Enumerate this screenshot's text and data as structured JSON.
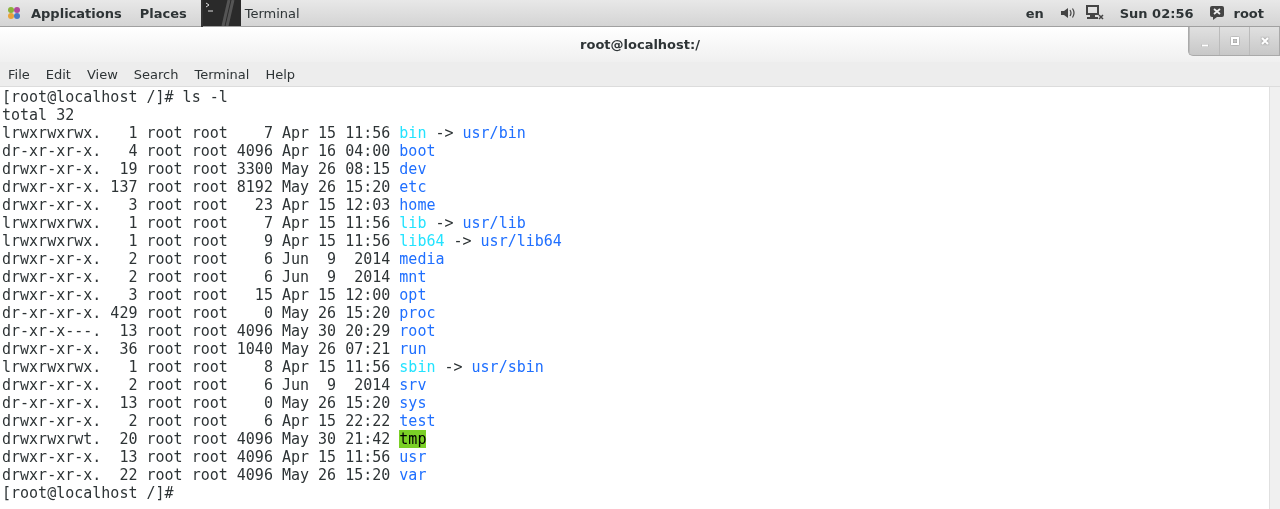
{
  "top_bar": {
    "menus": [
      "Applications",
      "Places"
    ],
    "task": {
      "label": "Terminal"
    },
    "language": "en",
    "clock": "Sun 02:56",
    "user": "root"
  },
  "window": {
    "title": "root@localhost:/"
  },
  "menu_bar": [
    "File",
    "Edit",
    "View",
    "Search",
    "Terminal",
    "Help"
  ],
  "terminal": {
    "lines": [
      {
        "kind": "text",
        "text": "[root@localhost /]# ls -l"
      },
      {
        "kind": "text",
        "text": "total 32"
      },
      {
        "kind": "entry",
        "info": "lrwxrwxrwx.   1 root root    7 Apr 15 11:56",
        "name": {
          "text": "bin",
          "kind": "link"
        },
        "arrow": "->",
        "target": "usr/bin"
      },
      {
        "kind": "entry",
        "info": "dr-xr-xr-x.   4 root root 4096 Apr 16 04:00",
        "name": {
          "text": "boot",
          "kind": "dir"
        }
      },
      {
        "kind": "entry",
        "info": "drwxr-xr-x.  19 root root 3300 May 26 08:15",
        "name": {
          "text": "dev",
          "kind": "dir"
        }
      },
      {
        "kind": "entry",
        "info": "drwxr-xr-x. 137 root root 8192 May 26 15:20",
        "name": {
          "text": "etc",
          "kind": "dir"
        }
      },
      {
        "kind": "entry",
        "info": "drwxr-xr-x.   3 root root   23 Apr 15 12:03",
        "name": {
          "text": "home",
          "kind": "dir"
        }
      },
      {
        "kind": "entry",
        "info": "lrwxrwxrwx.   1 root root    7 Apr 15 11:56",
        "name": {
          "text": "lib",
          "kind": "link"
        },
        "arrow": "->",
        "target": "usr/lib"
      },
      {
        "kind": "entry",
        "info": "lrwxrwxrwx.   1 root root    9 Apr 15 11:56",
        "name": {
          "text": "lib64",
          "kind": "link"
        },
        "arrow": "->",
        "target": "usr/lib64"
      },
      {
        "kind": "entry",
        "info": "drwxr-xr-x.   2 root root    6 Jun  9  2014",
        "name": {
          "text": "media",
          "kind": "dir"
        }
      },
      {
        "kind": "entry",
        "info": "drwxr-xr-x.   2 root root    6 Jun  9  2014",
        "name": {
          "text": "mnt",
          "kind": "dir"
        }
      },
      {
        "kind": "entry",
        "info": "drwxr-xr-x.   3 root root   15 Apr 15 12:00",
        "name": {
          "text": "opt",
          "kind": "dir"
        }
      },
      {
        "kind": "entry",
        "info": "dr-xr-xr-x. 429 root root    0 May 26 15:20",
        "name": {
          "text": "proc",
          "kind": "dir"
        }
      },
      {
        "kind": "entry",
        "info": "dr-xr-x---.  13 root root 4096 May 30 20:29",
        "name": {
          "text": "root",
          "kind": "dir"
        }
      },
      {
        "kind": "entry",
        "info": "drwxr-xr-x.  36 root root 1040 May 26 07:21",
        "name": {
          "text": "run",
          "kind": "dir"
        }
      },
      {
        "kind": "entry",
        "info": "lrwxrwxrwx.   1 root root    8 Apr 15 11:56",
        "name": {
          "text": "sbin",
          "kind": "link"
        },
        "arrow": "->",
        "target": "usr/sbin"
      },
      {
        "kind": "entry",
        "info": "drwxr-xr-x.   2 root root    6 Jun  9  2014",
        "name": {
          "text": "srv",
          "kind": "dir"
        }
      },
      {
        "kind": "entry",
        "info": "dr-xr-xr-x.  13 root root    0 May 26 15:20",
        "name": {
          "text": "sys",
          "kind": "dir"
        }
      },
      {
        "kind": "entry",
        "info": "drwxr-xr-x.   2 root root    6 Apr 15 22:22",
        "name": {
          "text": "test",
          "kind": "dir"
        }
      },
      {
        "kind": "entry",
        "info": "drwxrwxrwt.  20 root root 4096 May 30 21:42",
        "name": {
          "text": "tmp",
          "kind": "sticky"
        }
      },
      {
        "kind": "entry",
        "info": "drwxr-xr-x.  13 root root 4096 Apr 15 11:56",
        "name": {
          "text": "usr",
          "kind": "dir"
        }
      },
      {
        "kind": "entry",
        "info": "drwxr-xr-x.  22 root root 4096 May 26 15:20",
        "name": {
          "text": "var",
          "kind": "dir"
        }
      },
      {
        "kind": "text",
        "text": "[root@localhost /]#"
      }
    ]
  }
}
